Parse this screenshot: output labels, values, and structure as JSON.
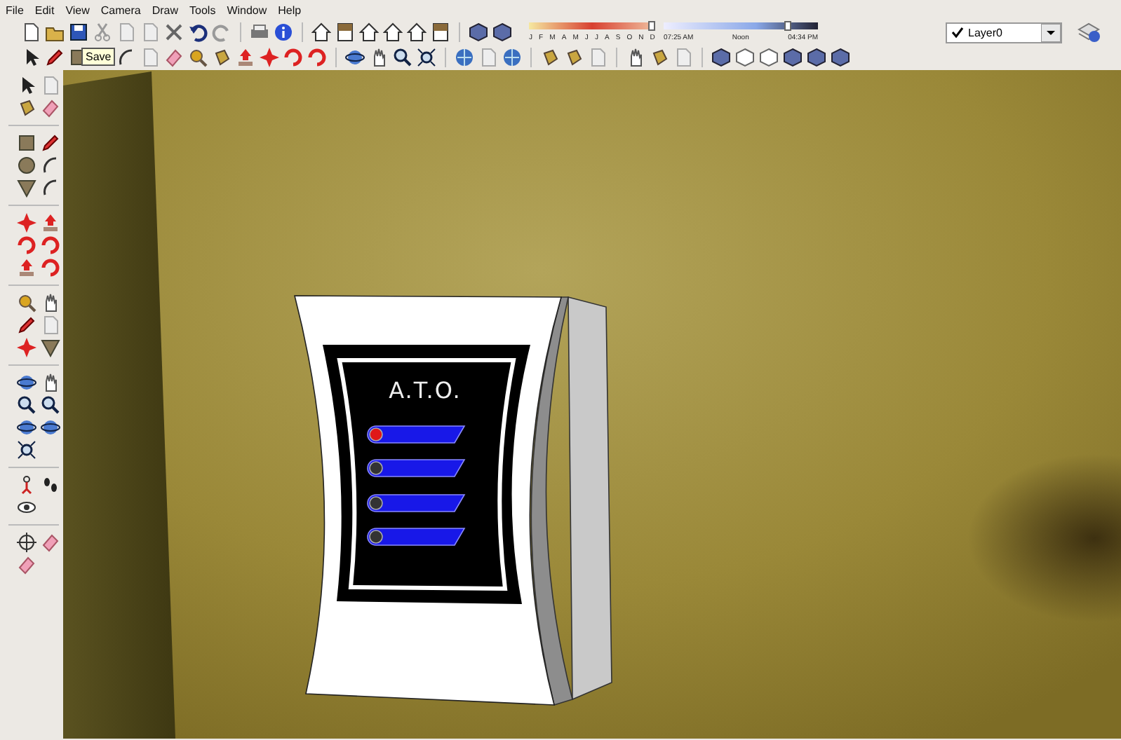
{
  "menu": [
    "File",
    "Edit",
    "View",
    "Camera",
    "Draw",
    "Tools",
    "Window",
    "Help"
  ],
  "tooltip": {
    "text": "Save"
  },
  "shadows": {
    "months": [
      "J",
      "F",
      "M",
      "A",
      "M",
      "J",
      "J",
      "A",
      "S",
      "O",
      "N",
      "D"
    ],
    "date_slider": {
      "level": 0.97
    },
    "time_slider": {
      "level": 0.8
    },
    "times": [
      "07:25 AM",
      "Noon",
      "04:34 PM"
    ]
  },
  "layer": {
    "name": "Layer0",
    "checked": true
  },
  "device": {
    "title": "A.T.O.",
    "indicators": [
      {
        "on": true
      },
      {
        "on": false
      },
      {
        "on": false
      },
      {
        "on": false
      }
    ]
  }
}
